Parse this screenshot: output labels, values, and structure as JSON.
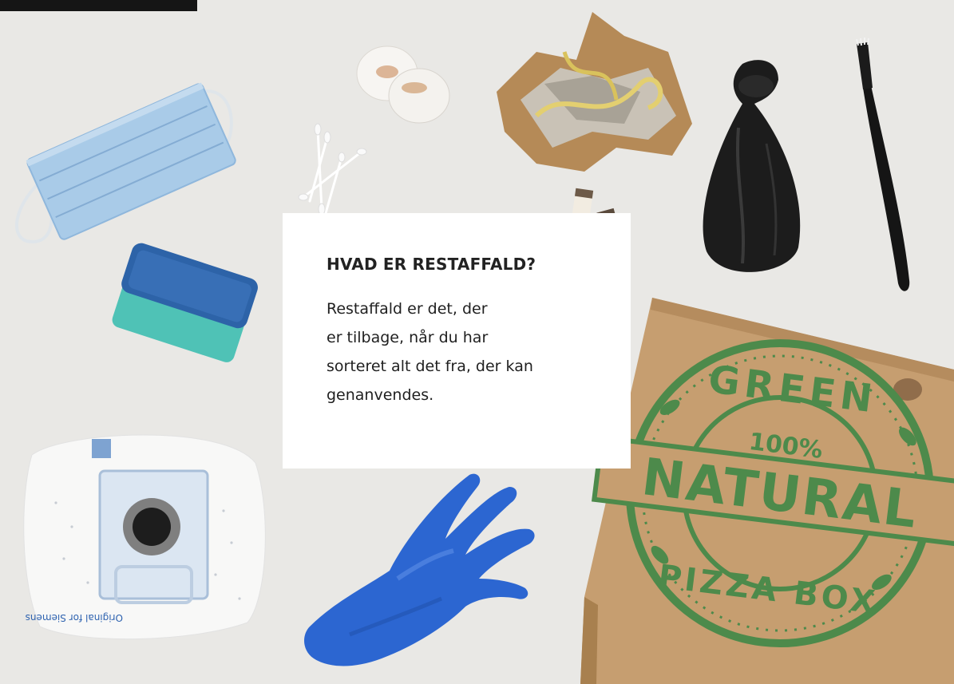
{
  "colors": {
    "background": "#e9e8e5",
    "card": "#ffffff",
    "title_text": "#222222",
    "body_text": "#1f1f1f",
    "stamp_green": "#4d8a4b",
    "cardboard": "#c69e70"
  },
  "info_card": {
    "title": "HVAD ER RESTAFFALD?",
    "body_lines": [
      "Restaffald er det, der",
      "er tilbage, når du har",
      "sorteret alt det fra, der kan",
      "genanvendes."
    ]
  },
  "pizza_box": {
    "stamp_top": "GREEN",
    "stamp_percent": "100%",
    "stamp_center": "NATURAL",
    "stamp_bottom": "PIZZA BOX"
  },
  "vacuum_bag": {
    "print_text": "Original for Siemens"
  },
  "icons": [
    "face-mask-icon",
    "cotton-pads-icon",
    "cotton-swabs-icon",
    "foil-wrapping-icon",
    "trash-bag-icon",
    "toothbrush-icon",
    "sponge-icon",
    "cigarette-butts-icon",
    "vacuum-bag-icon",
    "rubber-glove-icon",
    "pizza-box-icon"
  ]
}
